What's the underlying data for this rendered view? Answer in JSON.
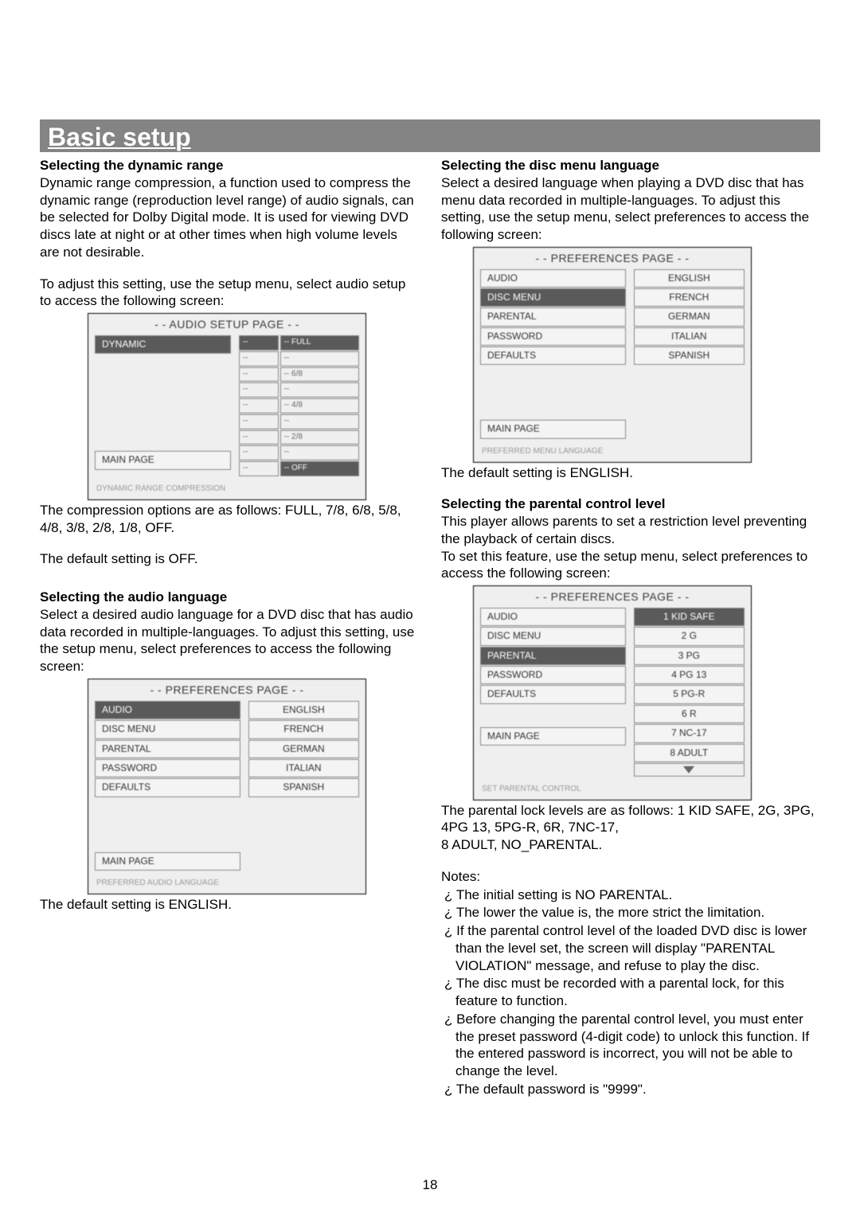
{
  "title": "Basic setup",
  "page_number": "18",
  "col_left": {
    "h1": "Selecting the dynamic range",
    "p1": "Dynamic range compression, a function used to compress the dynamic range (reproduction level range) of audio signals, can be selected for Dolby Digital mode. It is used for viewing DVD discs late at night or at other times when high volume levels are not desirable.",
    "p2": "To adjust this setting, use the setup menu, select audio setup to access the following screen:",
    "screen1": {
      "title": "- - AUDIO SETUP PAGE - -",
      "dynamic": "DYNAMIC",
      "mainpage": "MAIN PAGE",
      "footer": "DYNAMIC RANGE COMPRESSION",
      "r1a": "--",
      "r1b": "-- FULL",
      "r2a": "--",
      "r2b": "--",
      "r3a": "--",
      "r3b": "-- 6/8",
      "r4a": "--",
      "r4b": "--",
      "r5a": "--",
      "r5b": "-- 4/8",
      "r6a": "--",
      "r6b": "--",
      "r7a": "--",
      "r7b": "-- 2/8",
      "r8a": "--",
      "r8b": "--",
      "r9a": "--",
      "r9b": "-- OFF"
    },
    "p3": "The compression options are as follows: FULL, 7/8, 6/8, 5/8, 4/8, 3/8, 2/8, 1/8, OFF.",
    "p4": "The default setting is OFF.",
    "h2": "Selecting the audio language",
    "p5": "Select a desired audio language for a DVD disc that has audio data recorded in multiple-languages. To adjust this setting, use the setup menu, select preferences to access the following screen:",
    "screen2": {
      "title": "- - PREFERENCES PAGE - -",
      "left": [
        "AUDIO",
        "DISC MENU",
        "PARENTAL",
        "PASSWORD",
        "DEFAULTS"
      ],
      "right": [
        "ENGLISH",
        "FRENCH",
        "GERMAN",
        "ITALIAN",
        "SPANISH"
      ],
      "mainpage": "MAIN PAGE",
      "footer": "PREFERRED AUDIO LANGUAGE"
    },
    "p6": "The default setting is ENGLISH."
  },
  "col_right": {
    "h1": "Selecting the disc menu language",
    "p1": "Select a desired language when playing a DVD disc that has menu data recorded in multiple-languages. To adjust this setting, use the setup menu, select preferences to access the following screen:",
    "screen1": {
      "title": "- - PREFERENCES PAGE - -",
      "left": [
        "AUDIO",
        "DISC MENU",
        "PARENTAL",
        "PASSWORD",
        "DEFAULTS"
      ],
      "right": [
        "ENGLISH",
        "FRENCH",
        "GERMAN",
        "ITALIAN",
        "SPANISH"
      ],
      "mainpage": "MAIN PAGE",
      "footer": "PREFERRED MENU LANGUAGE"
    },
    "p2": "The default setting is ENGLISH.",
    "h2": "Selecting the parental control level",
    "p3": "This player allows parents to set a restriction level preventing the playback of certain discs.",
    "p4": "To set this feature, use the setup menu, select preferences to access the following screen:",
    "screen2": {
      "title": "- - PREFERENCES PAGE - -",
      "left": [
        "AUDIO",
        "DISC MENU",
        "PARENTAL",
        "PASSWORD",
        "DEFAULTS"
      ],
      "right": [
        "1 KID SAFE",
        "2 G",
        "3 PG",
        "4 PG 13",
        "5 PG-R",
        "6 R",
        "7 NC-17",
        "8 ADULT"
      ],
      "mainpage": "MAIN PAGE",
      "footer": "SET PARENTAL CONTROL"
    },
    "p5": "The parental lock levels are as follows: 1 KID SAFE, 2G, 3PG, 4PG 13, 5PG-R, 6R, 7NC-17,",
    "p5b": "8 ADULT, NO_PARENTAL.",
    "notes_label": "Notes:",
    "notes": [
      "The initial setting is NO PARENTAL.",
      "The lower the value is, the more strict the limitation.",
      "If the parental control level of the loaded DVD disc is lower than the level set, the screen will display \"PARENTAL VIOLATION\" message, and refuse to play the disc.",
      "The disc must be recorded with a parental lock, for this feature to function.",
      "Before changing the parental control level, you must enter the preset password (4-digit code) to unlock this function. If the entered password is incorrect, you will not be able to change the level.",
      "The default password is \"9999\"."
    ],
    "bullet": "¿"
  }
}
